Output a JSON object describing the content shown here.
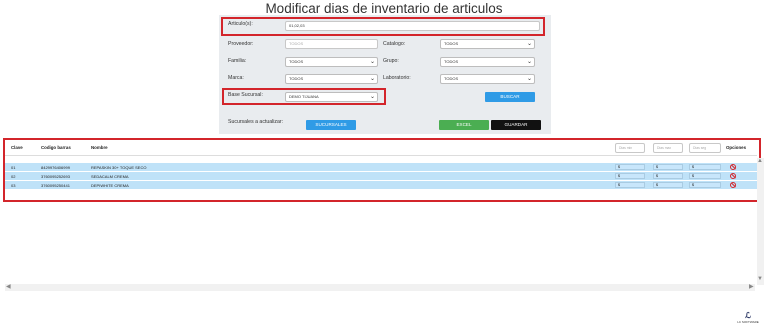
{
  "page": {
    "title": "Modificar dias de inventario de articulos"
  },
  "filters": {
    "articulos": {
      "label": "Articulo(s):",
      "value": "01,02,03"
    },
    "proveedor": {
      "label": "Proveedor:",
      "placeholder": "TODOS"
    },
    "catalogo": {
      "label": "Catalogo:",
      "value": "TODOS"
    },
    "familia": {
      "label": "Familia:",
      "value": "TODOS"
    },
    "grupo": {
      "label": "Grupo:",
      "value": "TODOS"
    },
    "marca": {
      "label": "Marca:",
      "value": "TODOS"
    },
    "laboratorio": {
      "label": "Laboratorio:",
      "value": "TODOS"
    },
    "base_sucursal": {
      "label": "Base Sucursal:",
      "value": "DEMO TIJUANA"
    },
    "buscar_label": "BUSCAR"
  },
  "actions": {
    "sucursales_label": "Sucursales a actualizar:",
    "sucursales_button": "SUCURSALES",
    "excel_button": "EXCEL",
    "guardar_button": "GUARDAR"
  },
  "table": {
    "headers": {
      "clave": "Clave",
      "codigo": "Codigo barras",
      "nombre": "Nombre",
      "dias_min_placeholder": "Dias min",
      "dias_max_placeholder": "Dias max",
      "dias_seg_placeholder": "Dias seg",
      "opciones": "Opciones"
    },
    "rows": [
      {
        "clave": "01",
        "codigo": "8429976406999",
        "nombre": "REPASKIN 30+ TOQUE SECO",
        "v1": "$",
        "v2": "$",
        "v3": "$"
      },
      {
        "clave": "02",
        "codigo": "3760095252693",
        "nombre": "SEDACALM CREMA",
        "v1": "$",
        "v2": "$",
        "v3": "$"
      },
      {
        "clave": "03",
        "codigo": "3760095250441",
        "nombre": "DEPIWHITE CREMA",
        "v1": "$",
        "v2": "$",
        "v3": "$"
      }
    ]
  },
  "logo": {
    "text": "LC SOFTWARE"
  },
  "colors": {
    "highlight": "#d3252b",
    "primary": "#2f9be6",
    "success": "#4bae52",
    "row": "#bfe2f8"
  }
}
